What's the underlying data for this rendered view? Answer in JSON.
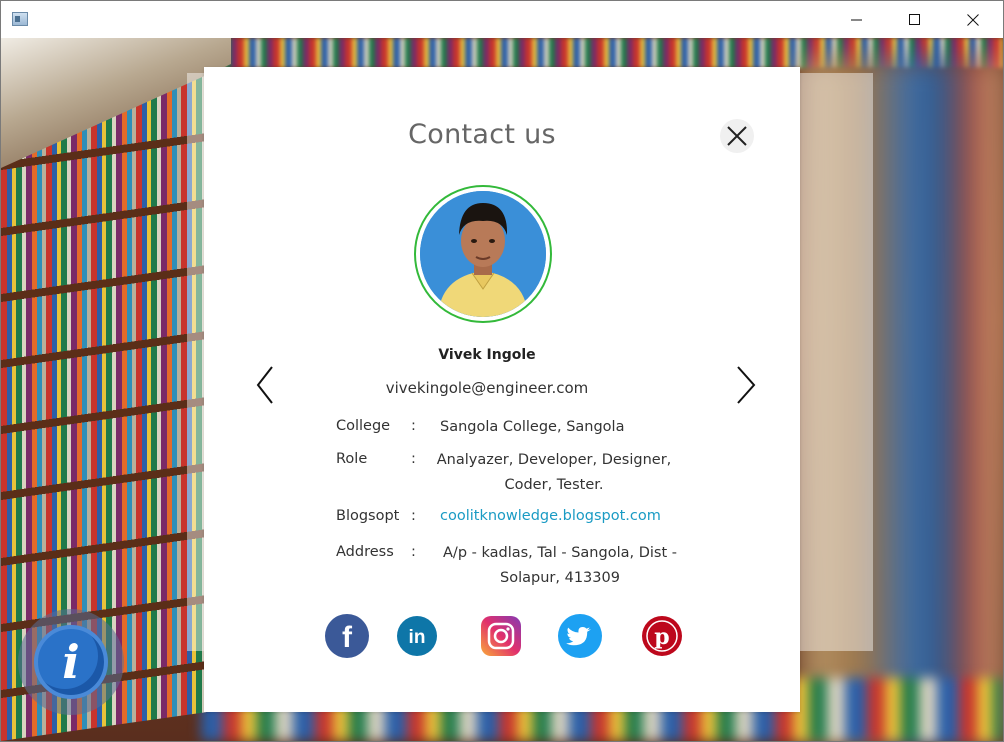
{
  "window": {
    "title": "",
    "controls": {
      "minimize": "minimize",
      "maximize": "maximize",
      "close": "close"
    }
  },
  "dialog": {
    "title": "Contact us",
    "profile": {
      "name": "Vivek Ingole",
      "email": "vivekingole@engineer.com"
    },
    "details": [
      {
        "label": "College",
        "separator": ":",
        "value": "Sangola College, Sangola"
      },
      {
        "label": "Role",
        "separator": ":",
        "value_line1": "Analyazer, Developer, Designer,",
        "value_line2": "Coder, Tester."
      },
      {
        "label": "Blogsopt",
        "separator": ":",
        "value": "coolitknowledge.blogspot.com"
      },
      {
        "label": "Address",
        "separator": ":",
        "value_line1": "A/p - kadlas, Tal - Sangola, Dist -",
        "value_line2": "Solapur, 413309"
      }
    ],
    "social": [
      {
        "name": "facebook",
        "icon": "facebook-icon",
        "color": "#3b5998"
      },
      {
        "name": "linkedin",
        "icon": "linkedin-icon",
        "color": "#0e76a8"
      },
      {
        "name": "instagram",
        "icon": "instagram-icon",
        "color": "#c13584"
      },
      {
        "name": "twitter",
        "icon": "twitter-icon",
        "color": "#1da1f2"
      },
      {
        "name": "pinterest",
        "icon": "pinterest-icon",
        "color": "#bd081c"
      }
    ],
    "colors": {
      "ring": "#33b93a",
      "link": "#1a9bc4",
      "title": "#666666"
    }
  },
  "info_button": {
    "icon": "info-icon",
    "glyph": "i"
  }
}
